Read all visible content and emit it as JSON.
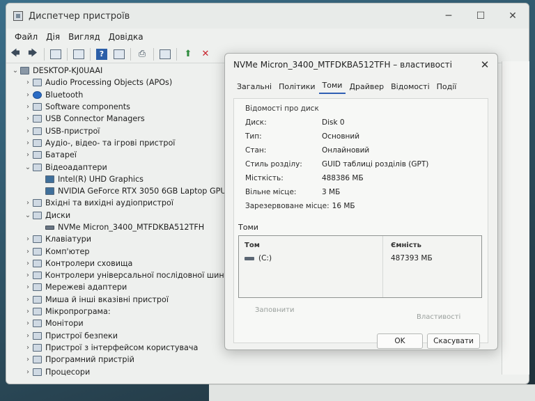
{
  "window": {
    "title": "Диспетчер пристроїв"
  },
  "menu": [
    "Файл",
    "Дія",
    "Вигляд",
    "Довідка"
  ],
  "tree": {
    "root": "DESKTOP-KJ0UAAI",
    "items": [
      {
        "label": "Audio Processing Objects (APOs)",
        "level": 1,
        "expanded": false
      },
      {
        "label": "Bluetooth",
        "level": 1,
        "expanded": false
      },
      {
        "label": "Software components",
        "level": 1,
        "expanded": false
      },
      {
        "label": "USB Connector Managers",
        "level": 1,
        "expanded": false
      },
      {
        "label": "USB-пристрої",
        "level": 1,
        "expanded": false
      },
      {
        "label": "Аудіо-, відео- та ігрові пристрої",
        "level": 1,
        "expanded": false
      },
      {
        "label": "Батареї",
        "level": 1,
        "expanded": false
      },
      {
        "label": "Відеоадаптери",
        "level": 1,
        "expanded": true
      },
      {
        "label": "Intel(R) UHD Graphics",
        "level": 2
      },
      {
        "label": "NVIDIA GeForce RTX 3050 6GB Laptop GPU",
        "level": 2
      },
      {
        "label": "Вхідні та вихідні аудіопристрої",
        "level": 1,
        "expanded": false
      },
      {
        "label": "Диски",
        "level": 1,
        "expanded": true
      },
      {
        "label": "NVMe Micron_3400_MTFDKBA512TFH",
        "level": 2
      },
      {
        "label": "Клавіатури",
        "level": 1,
        "expanded": false
      },
      {
        "label": "Комп'ютер",
        "level": 1,
        "expanded": false
      },
      {
        "label": "Контролери сховища",
        "level": 1,
        "expanded": false
      },
      {
        "label": "Контролери універсальної послідовної шини",
        "level": 1,
        "expanded": false
      },
      {
        "label": "Мережеві адаптери",
        "level": 1,
        "expanded": false
      },
      {
        "label": "Миша й інші вказівні пристрої",
        "level": 1,
        "expanded": false
      },
      {
        "label": "Мікропрограма:",
        "level": 1,
        "expanded": false
      },
      {
        "label": "Монітори",
        "level": 1,
        "expanded": false
      },
      {
        "label": "Пристрої безпеки",
        "level": 1,
        "expanded": false
      },
      {
        "label": "Пристрої з інтерфейсом користувача",
        "level": 1,
        "expanded": false
      },
      {
        "label": "Програмний пристрій",
        "level": 1,
        "expanded": false
      },
      {
        "label": "Процесори",
        "level": 1,
        "expanded": false
      }
    ]
  },
  "dialog": {
    "title": "NVMe Micron_3400_MTFDKBA512TFH – властивості",
    "tabs": [
      "Загальні",
      "Політики",
      "Томи",
      "Драйвер",
      "Відомості",
      "Події"
    ],
    "active_tab": "Томи",
    "disk_info_label": "Відомості про диск",
    "fields": [
      {
        "k": "Диск:",
        "v": "Disk 0"
      },
      {
        "k": "Тип:",
        "v": "Основний"
      },
      {
        "k": "Стан:",
        "v": "Онлайновий"
      },
      {
        "k": "Стиль розділу:",
        "v": "GUID таблиці розділів (GPT)"
      },
      {
        "k": "Місткість:",
        "v": "488386 МБ"
      },
      {
        "k": "Вільне місце:",
        "v": "3 МБ"
      },
      {
        "k": "Зарезервоване місце:",
        "v": "16 МБ"
      }
    ],
    "volumes_label": "Томи",
    "vol_col_volume": "Том",
    "vol_col_capacity": "Ємність",
    "volume": {
      "name": "(C:)",
      "capacity": "487393 МБ"
    },
    "populate_btn": "Заповнити",
    "properties_btn": "Властивості",
    "ok_btn": "OK",
    "cancel_btn": "Скасувати"
  }
}
